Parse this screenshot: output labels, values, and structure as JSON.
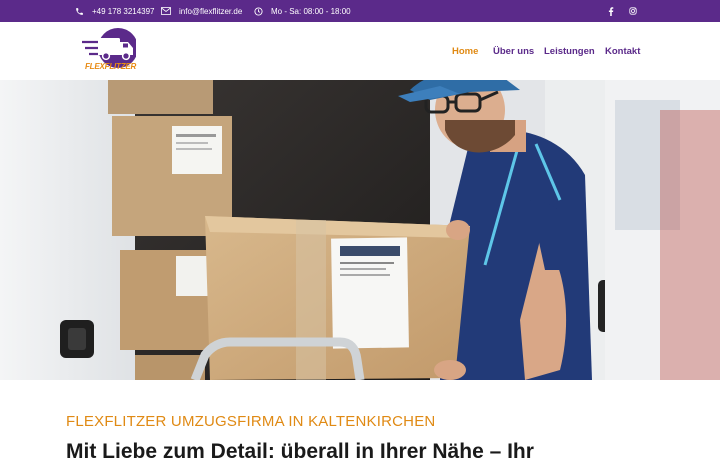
{
  "topbar": {
    "phone": "+49 178 3214397",
    "email": "info@flexflitzer.de",
    "hours": "Mo - Sa: 08:00 - 18:00",
    "social": [
      "facebook-icon",
      "instagram-icon"
    ]
  },
  "logo": {
    "text": "FLEXFLITZER"
  },
  "nav": {
    "items": [
      {
        "label": "Home",
        "active": true
      },
      {
        "label": "Über uns",
        "active": false
      },
      {
        "label": "Leistungen",
        "active": false
      },
      {
        "label": "Kontakt",
        "active": false
      }
    ]
  },
  "hero": {
    "image": "Lieferant trägt Umzugskarton aus Transporter"
  },
  "content": {
    "subtitle": "FLEXFLITZER UMZUGSFIRMA IN KALTENKIRCHEN",
    "headline": "Mit Liebe zum Detail: überall in Ihrer Nähe – Ihr"
  },
  "colors": {
    "brand_purple": "#5b2a8a",
    "accent_orange": "#e08a14"
  }
}
